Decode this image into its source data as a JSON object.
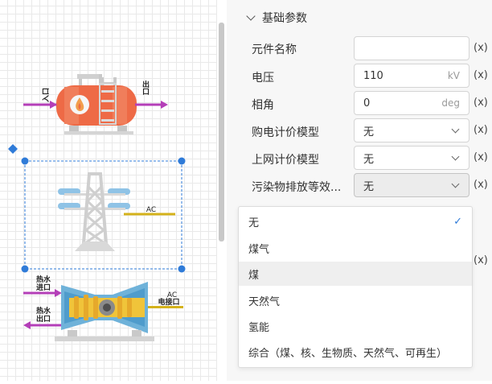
{
  "canvas": {
    "tank": {
      "inlet_label": "入口",
      "outlet_label": "出口"
    },
    "tower": {
      "ac_label": "AC"
    },
    "turbine": {
      "hot_in_label": "热水\n进口",
      "hot_out_label": "热水\n出口",
      "ac_label": "AC\n电接口"
    }
  },
  "panel": {
    "section_title": "基础参数",
    "rows": [
      {
        "label": "元件名称",
        "value": "",
        "unit": "",
        "type": "text"
      },
      {
        "label": "电压",
        "value": "110",
        "unit": "kV",
        "type": "number"
      },
      {
        "label": "相角",
        "value": "0",
        "unit": "deg",
        "type": "number"
      },
      {
        "label": "购电计价模型",
        "value": "无",
        "type": "select"
      },
      {
        "label": "上网计价模型",
        "value": "无",
        "type": "select"
      },
      {
        "label": "污染物排放等效...",
        "value": "无",
        "type": "select"
      }
    ],
    "expr_label": "(x)"
  },
  "dropdown": {
    "options": [
      "无",
      "煤气",
      "煤",
      "天然气",
      "氢能",
      "综合（煤、核、生物质、天然气、可再生）"
    ],
    "selected_index": 0,
    "hover_index": 2,
    "check_icon": "check-icon"
  },
  "colors": {
    "accent": "#2f7bd8",
    "tank": "#ee6a46",
    "purple_arrow": "#b43fb8",
    "ac_line": "#d4b21b"
  }
}
